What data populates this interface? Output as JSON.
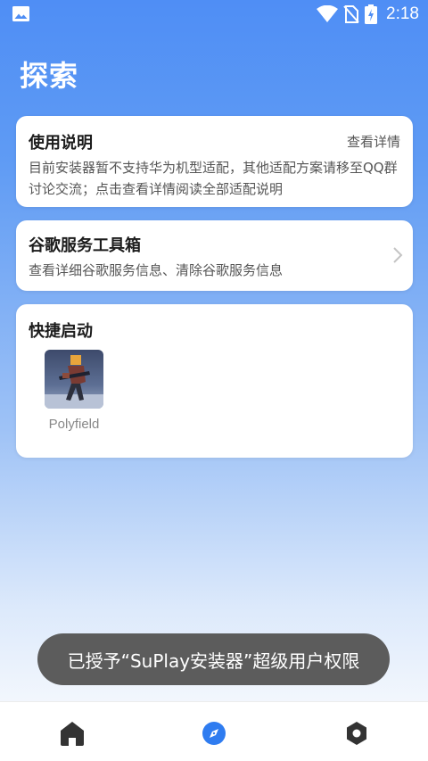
{
  "status_bar": {
    "time": "2:18",
    "icons": [
      "image-icon",
      "wifi-icon",
      "no-sim-icon",
      "battery-charging-icon"
    ]
  },
  "page": {
    "title": "探索"
  },
  "usage_card": {
    "title": "使用说明",
    "link": "查看详情",
    "description": "目前安装器暂不支持华为机型适配，其他适配方案请移至QQ群讨论交流；点击查看详情阅读全部适配说明"
  },
  "gms_card": {
    "title": "谷歌服务工具箱",
    "description": "查看详细谷歌服务信息、清除谷歌服务信息",
    "icon": "chevron-right-icon"
  },
  "quick_launch": {
    "title": "快捷启动",
    "apps": [
      {
        "label": "Polyfield",
        "icon": "polyfield-app-icon"
      }
    ]
  },
  "toast": {
    "message": "已授予“SuPlay安装器”超级用户权限"
  },
  "bottom_nav": {
    "items": [
      {
        "name": "home",
        "icon": "home-icon"
      },
      {
        "name": "explore",
        "icon": "compass-icon",
        "active": true
      },
      {
        "name": "settings",
        "icon": "hexagon-settings-icon"
      }
    ]
  },
  "colors": {
    "accent": "#2f7cf0",
    "header_blue": "#4f8ef5",
    "toast_bg": "#5c5c5c",
    "nav_icon": "#333333"
  }
}
